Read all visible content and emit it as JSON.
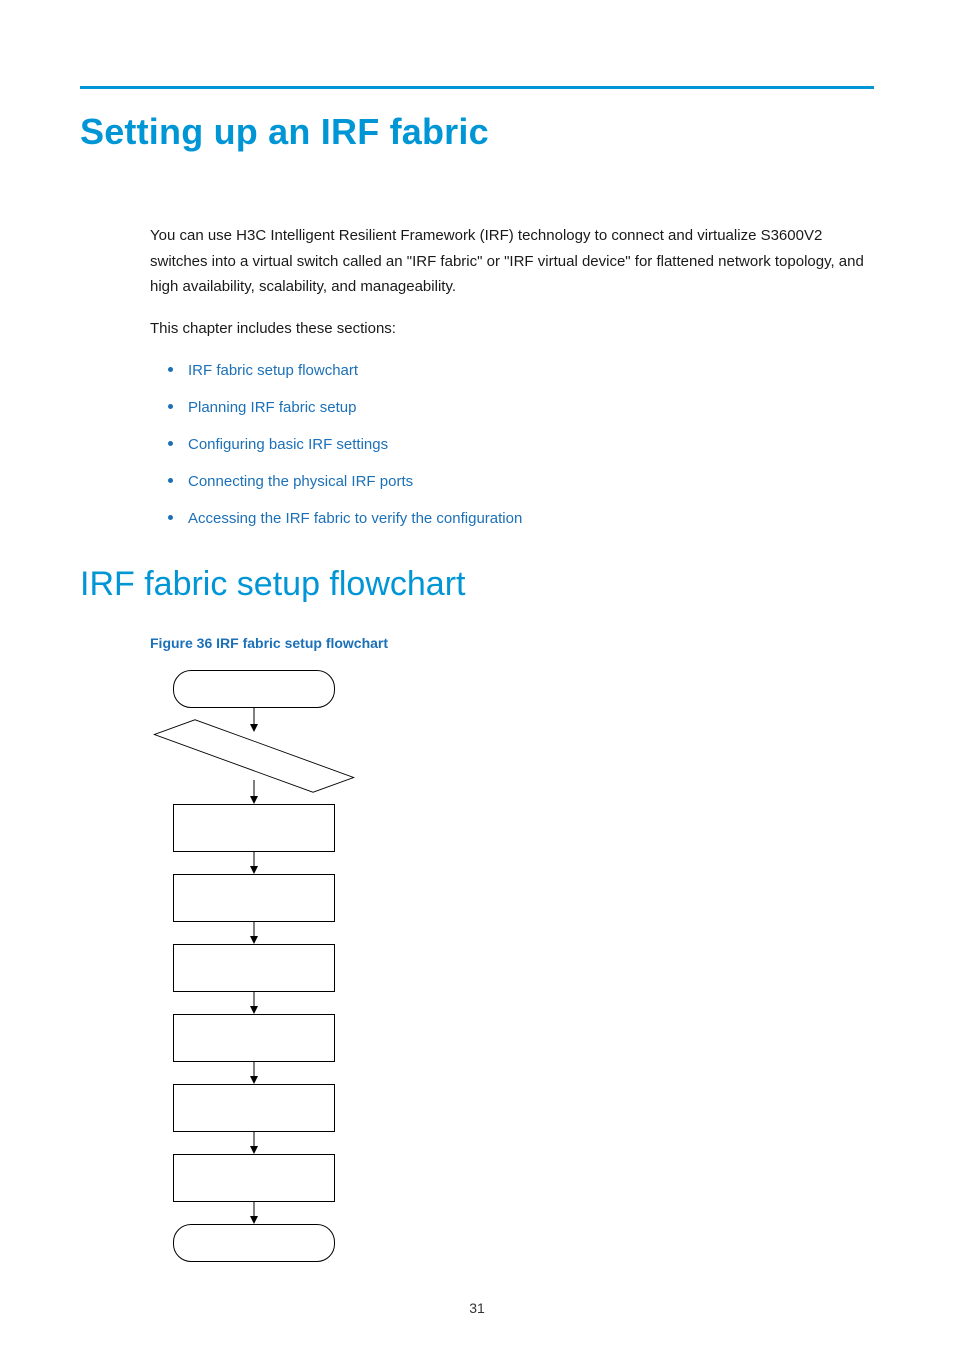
{
  "title": "Setting up an IRF fabric",
  "intro_paragraph": "You can use H3C Intelligent Resilient Framework (IRF) technology to connect and virtualize S3600V2 switches into a virtual switch called an \"IRF fabric\" or \"IRF virtual device\" for flattened network topology, and high availability, scalability, and manageability.",
  "toc_lead": "This chapter includes these sections:",
  "toc_links": [
    "IRF fabric setup flowchart",
    "Planning IRF fabric setup",
    "Configuring basic IRF settings",
    "Connecting the physical IRF ports",
    "Accessing the IRF fabric to verify the configuration"
  ],
  "section_heading": "IRF fabric setup flowchart",
  "figure_caption": "Figure 36 IRF fabric setup flowchart",
  "page_number": "31",
  "chart_data": {
    "type": "flowchart",
    "nodes": [
      {
        "id": "start",
        "shape": "terminal",
        "label": ""
      },
      {
        "id": "decision",
        "shape": "decision",
        "label": ""
      },
      {
        "id": "step1",
        "shape": "process",
        "label": ""
      },
      {
        "id": "step2",
        "shape": "process",
        "label": ""
      },
      {
        "id": "step3",
        "shape": "process",
        "label": ""
      },
      {
        "id": "step4",
        "shape": "process",
        "label": ""
      },
      {
        "id": "step5",
        "shape": "process",
        "label": ""
      },
      {
        "id": "step6",
        "shape": "process",
        "label": ""
      },
      {
        "id": "end",
        "shape": "terminal",
        "label": ""
      }
    ],
    "edges": [
      [
        "start",
        "decision"
      ],
      [
        "decision",
        "step1"
      ],
      [
        "step1",
        "step2"
      ],
      [
        "step2",
        "step3"
      ],
      [
        "step3",
        "step4"
      ],
      [
        "step4",
        "step5"
      ],
      [
        "step5",
        "step6"
      ],
      [
        "step6",
        "end"
      ]
    ]
  }
}
